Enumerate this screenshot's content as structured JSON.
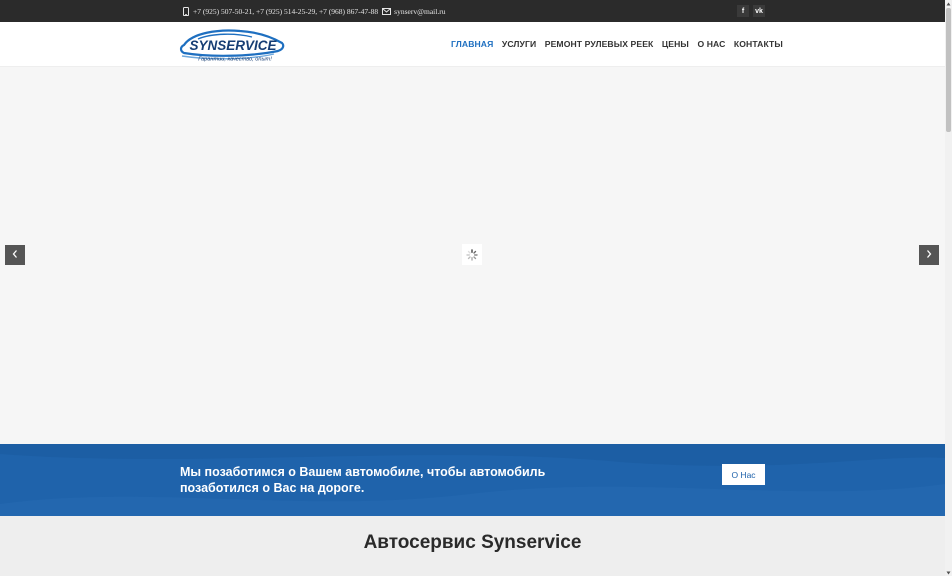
{
  "topbar": {
    "phones": "+7 (925) 507-50-21, +7 (925) 514-25-29, +7 (968) 867-47-88",
    "email": "synserv@mail.ru",
    "social": [
      {
        "icon": "facebook-icon",
        "label": "f"
      },
      {
        "icon": "vk-icon",
        "label": "vk"
      }
    ]
  },
  "logo": {
    "name": "SYNSERVICE",
    "slogan": "Гарантии, качество, опыт!"
  },
  "nav": {
    "items": [
      {
        "label": "ГЛАВНАЯ",
        "active": true
      },
      {
        "label": "УСЛУГИ",
        "active": false
      },
      {
        "label": "РЕМОНТ РУЛЕВЫХ РЕЕК",
        "active": false
      },
      {
        "label": "ЦЕНЫ",
        "active": false
      },
      {
        "label": "О НАС",
        "active": false
      },
      {
        "label": "КОНТАКТЫ",
        "active": false
      }
    ]
  },
  "banner": {
    "tagline": "Мы позаботимся о Вашем автомобиле, чтобы автомобиль позаботился о Вас на дороге.",
    "button_label": "О Нас"
  },
  "section": {
    "title": "Автосервис Synservice"
  },
  "colors": {
    "accent": "#1e6fc0",
    "banner": "#1f63ab",
    "topbar": "#2b2b2b"
  }
}
